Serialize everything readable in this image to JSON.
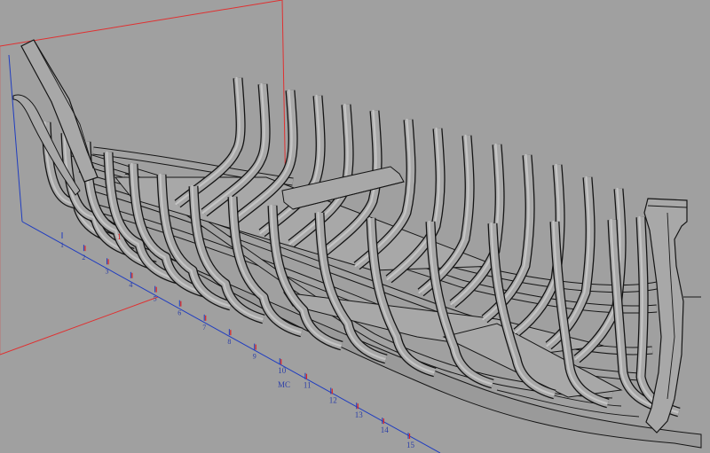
{
  "viewport": {
    "background": "#a0a0a0",
    "wire_color": "#151515",
    "axis_color": "#1f3cc0",
    "marker_color": "#e02020",
    "red_plane_color": "#e03030"
  },
  "stations": [
    {
      "label": "1",
      "red": false
    },
    {
      "label": "2",
      "red": true
    },
    {
      "label": "3",
      "red": true
    },
    {
      "label": "4",
      "red": true
    },
    {
      "label": "5",
      "red": true
    },
    {
      "label": "6",
      "red": true
    },
    {
      "label": "7",
      "red": true
    },
    {
      "label": "8",
      "red": true
    },
    {
      "label": "9",
      "red": true
    },
    {
      "label": "10",
      "red": true
    },
    {
      "label": "11",
      "red": true
    },
    {
      "label": "12",
      "red": true
    },
    {
      "label": "13",
      "red": true
    },
    {
      "label": "14",
      "red": true
    },
    {
      "label": "15",
      "red": true
    }
  ],
  "midship_label": "MC",
  "extra_label": "1",
  "frames_count_note": ""
}
